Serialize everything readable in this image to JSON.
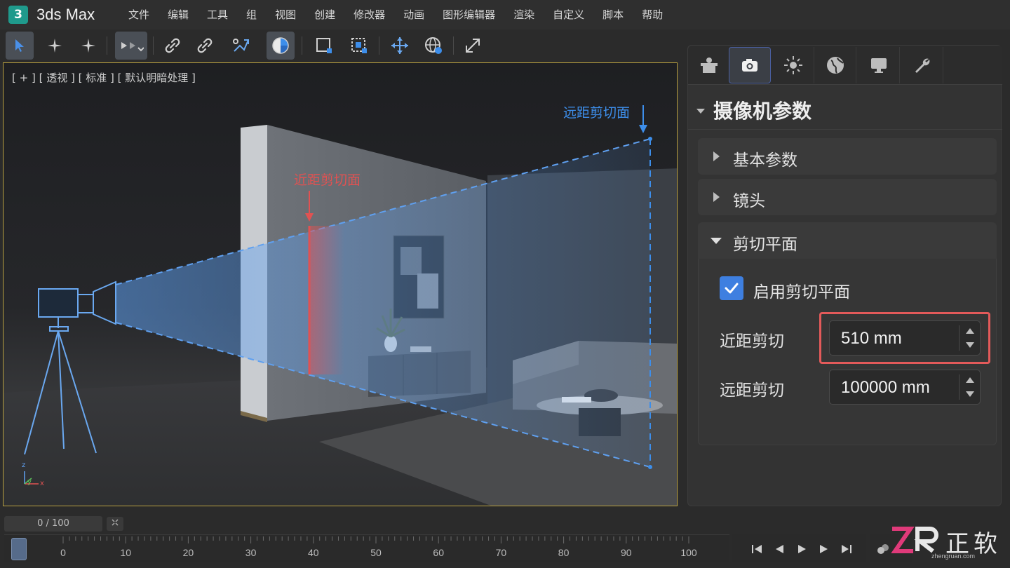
{
  "app": {
    "logo_glyph": "3",
    "title": "3ds Max"
  },
  "menu": [
    "文件",
    "编辑",
    "工具",
    "组",
    "视图",
    "创建",
    "修改器",
    "动画",
    "图形编辑器",
    "渲染",
    "自定义",
    "脚本",
    "帮助"
  ],
  "toolbar": {
    "icons": [
      "select-arrow-icon",
      "snap-star-icon",
      "snap-star-2-icon",
      "select-region-icon",
      "link-icon",
      "unlink-icon",
      "bind-spacewarp-icon",
      "render-shade-icon",
      "rect-select-icon",
      "window-select-icon",
      "move-icon",
      "rotate-globe-icon",
      "scale-icon"
    ],
    "active": "render-shade-icon"
  },
  "viewport": {
    "label": "[ + ] [ 透视 ] [ 标准 ] [ 默认明暗处理 ]",
    "near_clip_label": "近距剪切面",
    "far_clip_label": "远距剪切面",
    "axis_labels": {
      "z": "z",
      "y": "y",
      "x": "x"
    },
    "colors": {
      "near": "#e05252",
      "far": "#3d8eea",
      "frustum": "#5fa0f0"
    }
  },
  "panel": {
    "tabs": [
      "create-icon",
      "camera-icon",
      "light-icon",
      "globe-icon",
      "display-icon",
      "wrench-icon"
    ],
    "active_tab": "camera-icon",
    "title": "摄像机参数",
    "rollouts": {
      "basic": "基本参数",
      "lens": "镜头",
      "clip": "剪切平面"
    },
    "enable_clip": {
      "label": "启用剪切平面",
      "checked": true
    },
    "near_clip": {
      "label": "近距剪切",
      "value": "510 mm"
    },
    "far_clip": {
      "label": "远距剪切",
      "value": "100000 mm"
    }
  },
  "timeline": {
    "frame_counter": "0 / 100",
    "current_frame": 0,
    "ticks": [
      "0",
      "10",
      "20",
      "30",
      "40",
      "50",
      "60",
      "70",
      "80",
      "90",
      "100"
    ]
  },
  "watermark": {
    "text": "正软",
    "logo": "ZR",
    "sub": "zhengruan.com"
  }
}
